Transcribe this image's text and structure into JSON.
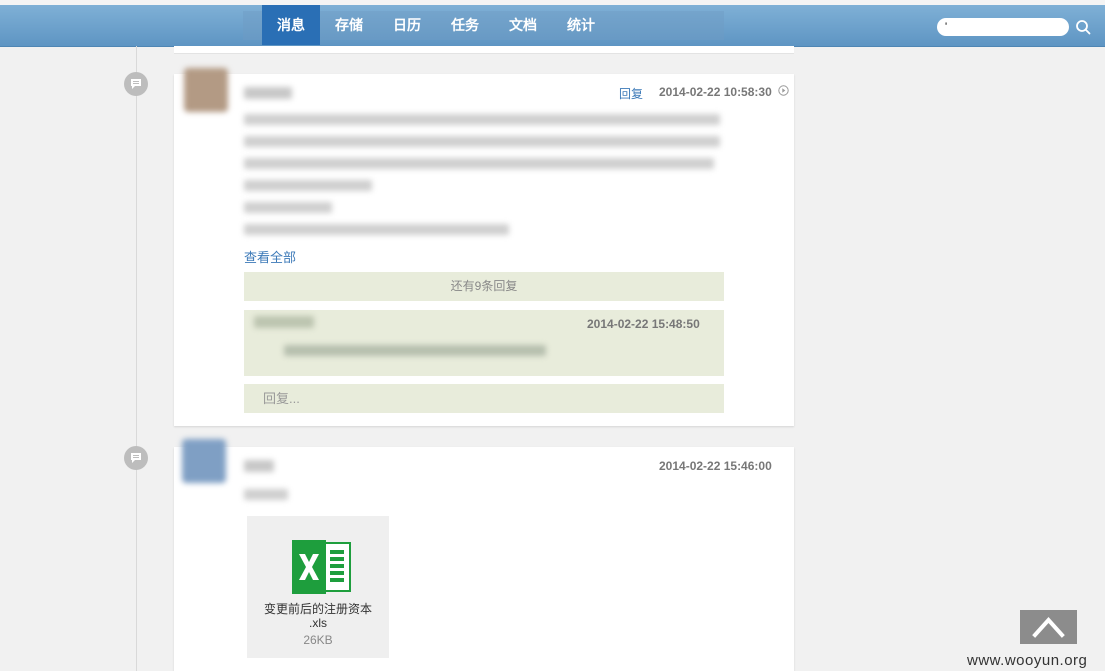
{
  "nav": {
    "items": [
      {
        "label": "消息",
        "active": true
      },
      {
        "label": "存储",
        "active": false
      },
      {
        "label": "日历",
        "active": false
      },
      {
        "label": "任务",
        "active": false
      },
      {
        "label": "文档",
        "active": false
      },
      {
        "label": "统计",
        "active": false
      }
    ],
    "search_value": "'",
    "search_icon": "search-icon"
  },
  "post1": {
    "reply_label": "回复",
    "timestamp": "2014-02-22 10:58:30",
    "view_all_label": "查看全部",
    "more_replies_label": "还有9条回复",
    "reply_item_timestamp": "2014-02-22 15:48:50",
    "reply_placeholder": "回复..."
  },
  "post2": {
    "timestamp": "2014-02-22 15:46:00",
    "attachment": {
      "name_line1": "变更前后的注册资本",
      "name_line2": ".xls",
      "size": "26KB",
      "icon": "excel-icon",
      "icon_color": "#1e9e3d"
    }
  },
  "back_to_top_icon": "chevron-up-icon",
  "watermark": "www.wooyun.org",
  "colors": {
    "accent": "#2a6fb5",
    "link": "#3d7ab8",
    "reply_bg": "#e8ecdb"
  }
}
